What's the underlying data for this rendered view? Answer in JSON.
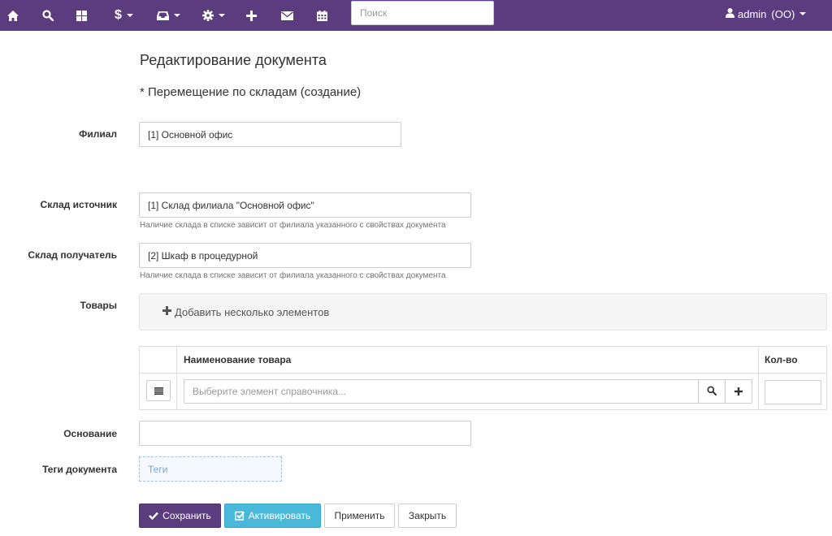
{
  "navbar": {
    "icons": [
      "home-icon",
      "search-icon",
      "dashboard-icon",
      "dollar-icon",
      "inbox-icon",
      "gear-icon",
      "plus-icon",
      "envelope-icon",
      "calendar-icon"
    ],
    "dollar_symbol": "$",
    "search_placeholder": "Поиск",
    "user": {
      "name": "admin",
      "org": "(ОО)"
    },
    "bg_color": "#5b3c7f"
  },
  "page": {
    "title": "Редактирование документа",
    "subtitle": "* Перемещение по складам (создание)"
  },
  "form": {
    "branch": {
      "label": "Филиал",
      "value": "[1] Основной офис"
    },
    "source_warehouse": {
      "label": "Склад источник",
      "value": "[1] Склад филиала \"Основной офис\"",
      "help": "Наличие склада в списке зависит от филиала указанного с свойствах документа"
    },
    "target_warehouse": {
      "label": "Склад получатель",
      "value": "[2] Шкаф в процедурной",
      "help": "Наличие склада в списке зависит от филиала указанного с свойствах документа"
    },
    "goods": {
      "label": "Товары",
      "add_several": "Добавить несколько элементов",
      "columns": [
        "Наименование товара",
        "Кол-во"
      ],
      "item_placeholder": "Выберите элемент справочника...",
      "quantity": ""
    },
    "basis": {
      "label": "Основание",
      "value": ""
    },
    "tags": {
      "label": "Теги документа",
      "placeholder": "Теги"
    }
  },
  "actions": {
    "save": "Сохранить",
    "activate": "Активировать",
    "apply": "Применить",
    "close": "Закрыть"
  }
}
